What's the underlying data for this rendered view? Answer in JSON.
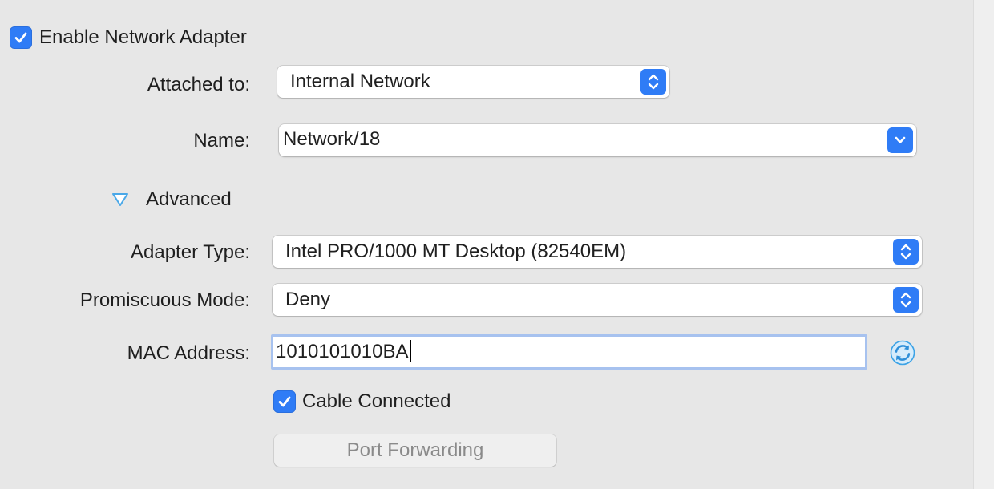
{
  "adapter": {
    "enable_label": "Enable Network Adapter",
    "enable_checked": true
  },
  "attached_to": {
    "label": "Attached to:",
    "value": "Internal Network"
  },
  "name": {
    "label": "Name:",
    "value": "Network/18"
  },
  "advanced": {
    "label": "Advanced",
    "expanded": true
  },
  "adapter_type": {
    "label": "Adapter Type:",
    "value": "Intel PRO/1000 MT Desktop (82540EM)"
  },
  "promiscuous_mode": {
    "label": "Promiscuous Mode:",
    "value": "Deny"
  },
  "mac_address": {
    "label": "MAC Address:",
    "value": "1010101010BA"
  },
  "cable": {
    "label": "Cable Connected",
    "checked": true
  },
  "port_forwarding": {
    "label": "Port Forwarding",
    "enabled": false
  },
  "colors": {
    "accent": "#2f7cf6",
    "background": "#e7e7e7",
    "disclosure": "#4aa8e8",
    "focus_ring": "#a7c2ef",
    "refresh_icon": "#3ba2e6"
  },
  "icons": {
    "checkbox": "checkmark-icon",
    "popup": "updown-chevron-icon",
    "combo": "chevron-down-icon",
    "disclosure": "disclosure-triangle-down-icon",
    "mac_refresh": "refresh-icon"
  }
}
